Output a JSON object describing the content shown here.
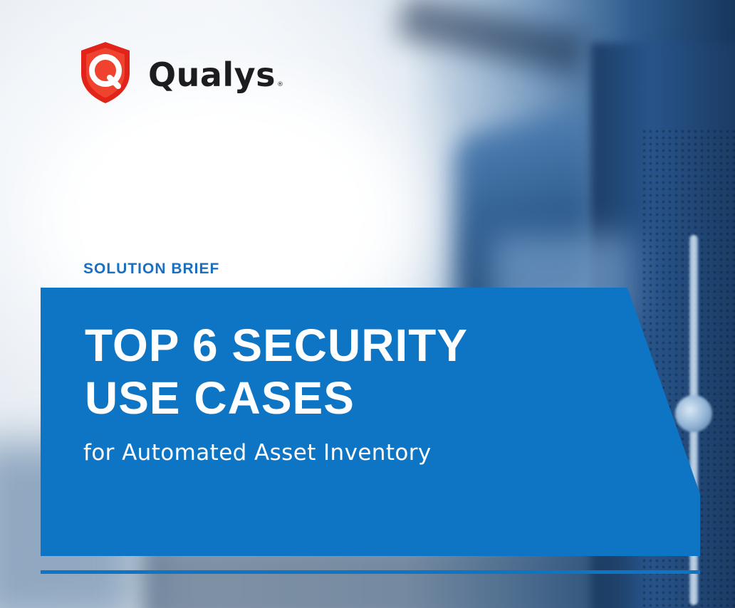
{
  "brand": {
    "name": "Qualys",
    "registered_mark": "®",
    "logo_icon": "qualys-shield-icon",
    "shield_color": "#e2231a"
  },
  "cover": {
    "eyebrow": "SOLUTION BRIEF",
    "title_line_1": "TOP 6 SECURITY",
    "title_line_2": "USE CASES",
    "subtitle": "for Automated Asset Inventory"
  },
  "colors": {
    "accent_blue": "#0e75c5",
    "eyebrow_blue": "#1a6fbf",
    "title_text": "#ffffff",
    "logo_text": "#1d1d1f"
  }
}
